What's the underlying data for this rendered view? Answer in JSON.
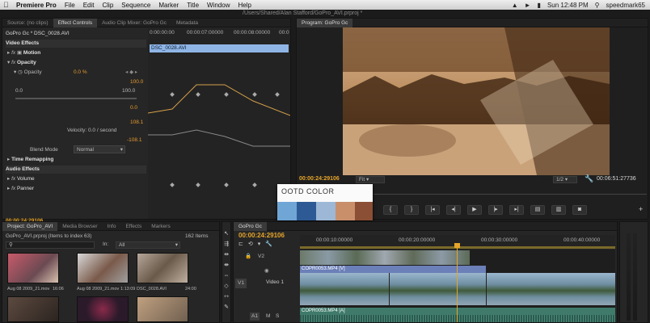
{
  "menubar": {
    "app": "Premiere Pro",
    "items": [
      "File",
      "Edit",
      "Clip",
      "Sequence",
      "Marker",
      "Title",
      "Window",
      "Help"
    ],
    "time": "Sun 12:48 PM",
    "user": "speedmark65"
  },
  "project_path": "/Users/Shared/Alan Stafford/GoPro_AVI.prproj *",
  "source_panel": {
    "tabs": [
      "Source: (no clips)",
      "Effect Controls",
      "Audio Clip Mixer: GoPro Gc",
      "Metadata"
    ],
    "clip_label": "GoPro Gc * DSC_0028.AVI",
    "ruler": [
      "0:00:00:00",
      "00:00:07:00000",
      "00:00:08:00000",
      "00:0"
    ],
    "clip_bar": "DSC_0028.AVI",
    "video_effects": "Video Effects",
    "motion": "Motion",
    "opacity": "Opacity",
    "opacity_param": "Opacity",
    "opacity_value": "0.0 %",
    "value_top": "100.0",
    "value_left": "0.0",
    "value_right": "100.0",
    "graph_top": "0.0",
    "velocity": "Velocity: 0.0 / second",
    "graph_mid": "108.1",
    "graph_bottom": "-108.1",
    "blend_mode": "Blend Mode",
    "blend_value": "Normal",
    "time_remapping": "Time Remapping",
    "audio_effects": "Audio Effects",
    "volume": "Volume",
    "panner": "Panner",
    "timecode": "00:00:24:29106"
  },
  "program_panel": {
    "tab": "Program: GoPro Gc",
    "timecode": "00:00:24:29106",
    "fit": "Fit",
    "zoom": "1/2",
    "duration": "00:06:51:27736"
  },
  "ootd": {
    "title": "OOTD COLOR",
    "swatches": [
      "#6fa6d6",
      "#2d5a94",
      "#9cb8d6",
      "#c98f6b",
      "#8a4f34"
    ]
  },
  "project_panel": {
    "tabs": [
      "Project: GoPro_AVI",
      "Media Browser",
      "Info",
      "Effects",
      "Markers"
    ],
    "project_file": "GoPro_AVI.prproj (Items to index 63)",
    "item_count": "162 Items",
    "in_label": "In:",
    "in_value": "All",
    "thumbs": [
      {
        "label": "Aug 08 2009_21.mov",
        "dur": "16:06"
      },
      {
        "label": "Aug 08 2009_21.mov",
        "dur": "1:13:09"
      },
      {
        "label": "DSC_0028.AVI",
        "dur": "24:00"
      }
    ]
  },
  "timeline": {
    "tab": "GoPro Gc",
    "timecode": "00:00:24:29106",
    "ruler": [
      "00:00:10:00000",
      "00:00:20:00000",
      "00:00:30:00000",
      "00:00:40:00000"
    ],
    "tracks": {
      "v2": "V2",
      "v1": "V1",
      "video1": "Video 1",
      "a1": "A1"
    },
    "clip_v1": "COPR0053.MP4 [V]",
    "clip_a1": "COPR0053.MP4 [A]",
    "track_buttons": [
      "M",
      "S"
    ]
  }
}
